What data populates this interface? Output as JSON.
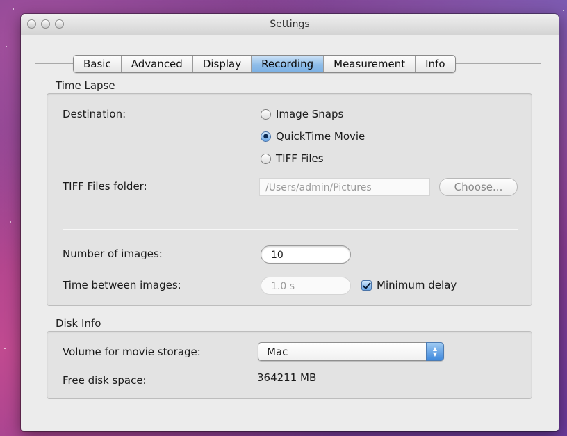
{
  "window": {
    "title": "Settings"
  },
  "tabs": [
    {
      "label": "Basic"
    },
    {
      "label": "Advanced"
    },
    {
      "label": "Display"
    },
    {
      "label": "Recording",
      "selected": true
    },
    {
      "label": "Measurement"
    },
    {
      "label": "Info"
    }
  ],
  "time_lapse": {
    "section_label": "Time Lapse",
    "destination_label": "Destination:",
    "destination_options": [
      {
        "label": "Image Snaps",
        "selected": false
      },
      {
        "label": "QuickTime Movie",
        "selected": true
      },
      {
        "label": "TIFF Files",
        "selected": false
      }
    ],
    "tiff_folder_label": "TIFF Files folder:",
    "tiff_folder_value": "/Users/admin/Pictures",
    "choose_button_label": "Choose...",
    "number_of_images_label": "Number of images:",
    "number_of_images_value": "10",
    "time_between_label": "Time between images:",
    "time_between_value": "1.0 s",
    "minimum_delay_label": "Minimum delay",
    "minimum_delay_checked": true
  },
  "disk_info": {
    "section_label": "Disk Info",
    "volume_label": "Volume for movie storage:",
    "volume_value": "Mac",
    "free_space_label": "Free disk space:",
    "free_space_value": "364211 MB"
  },
  "colors": {
    "selected_tab": "#8fbde8",
    "control_accent": "#3f88dc",
    "window_bg": "#ececec"
  }
}
